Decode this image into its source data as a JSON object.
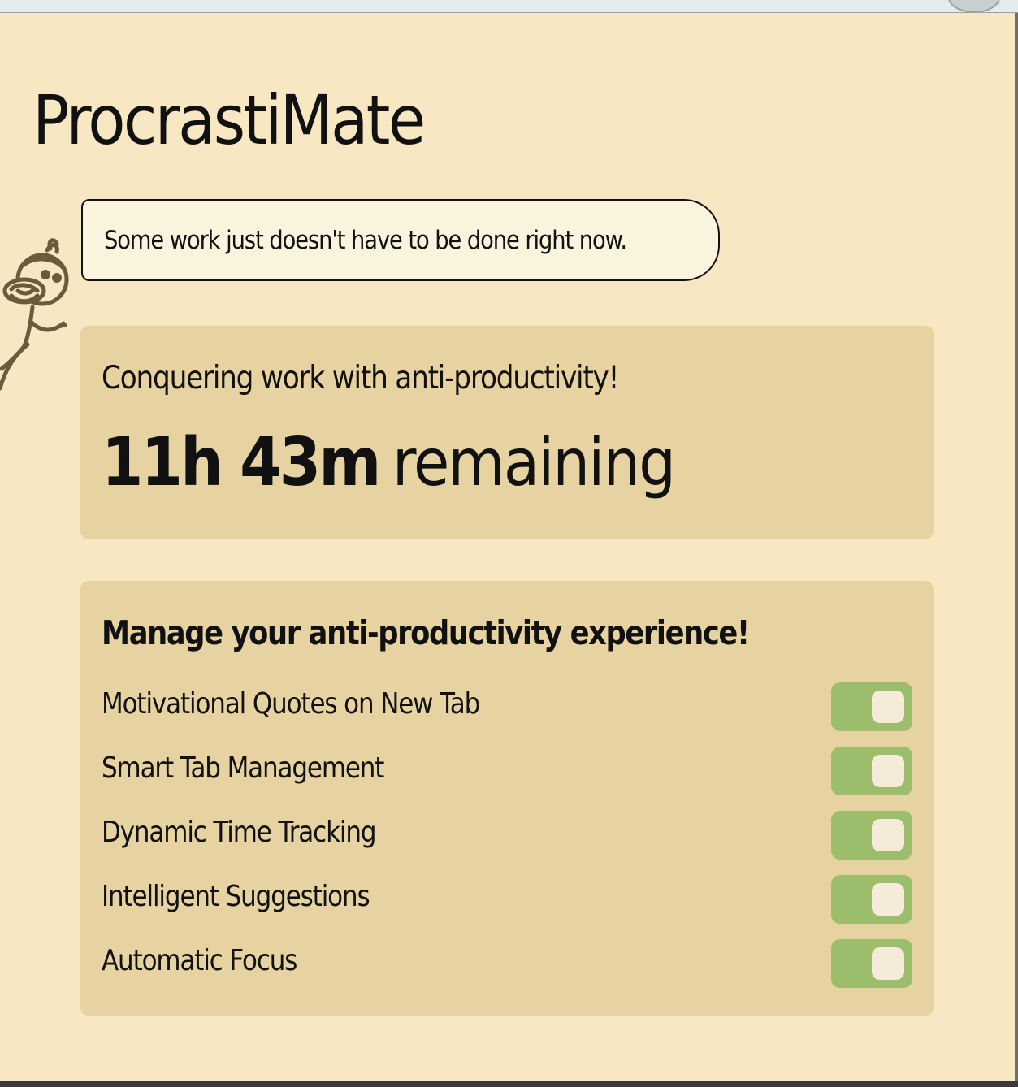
{
  "app": {
    "title": "ProcrastiMate"
  },
  "speech_bubble": {
    "text": "Some work just doesn't have to be done right now."
  },
  "timer": {
    "tagline": "Conquering work with anti-productivity!",
    "time_remaining": "11h 43m",
    "suffix": "remaining"
  },
  "settings": {
    "heading": "Manage your anti-productivity experience!",
    "items": [
      {
        "label": "Motivational Quotes on New Tab",
        "enabled": true
      },
      {
        "label": "Smart Tab Management",
        "enabled": true
      },
      {
        "label": "Dynamic Time Tracking",
        "enabled": true
      },
      {
        "label": "Intelligent Suggestions",
        "enabled": true
      },
      {
        "label": "Automatic Focus",
        "enabled": true
      }
    ]
  },
  "colors": {
    "background": "#f7e7c2",
    "card": "#e6d3a1",
    "toggle_on": "#9bbd6c",
    "toggle_knob": "#f6ebd8",
    "text": "#111111"
  },
  "icons": {
    "mascot": "monkey-doodle-icon"
  }
}
